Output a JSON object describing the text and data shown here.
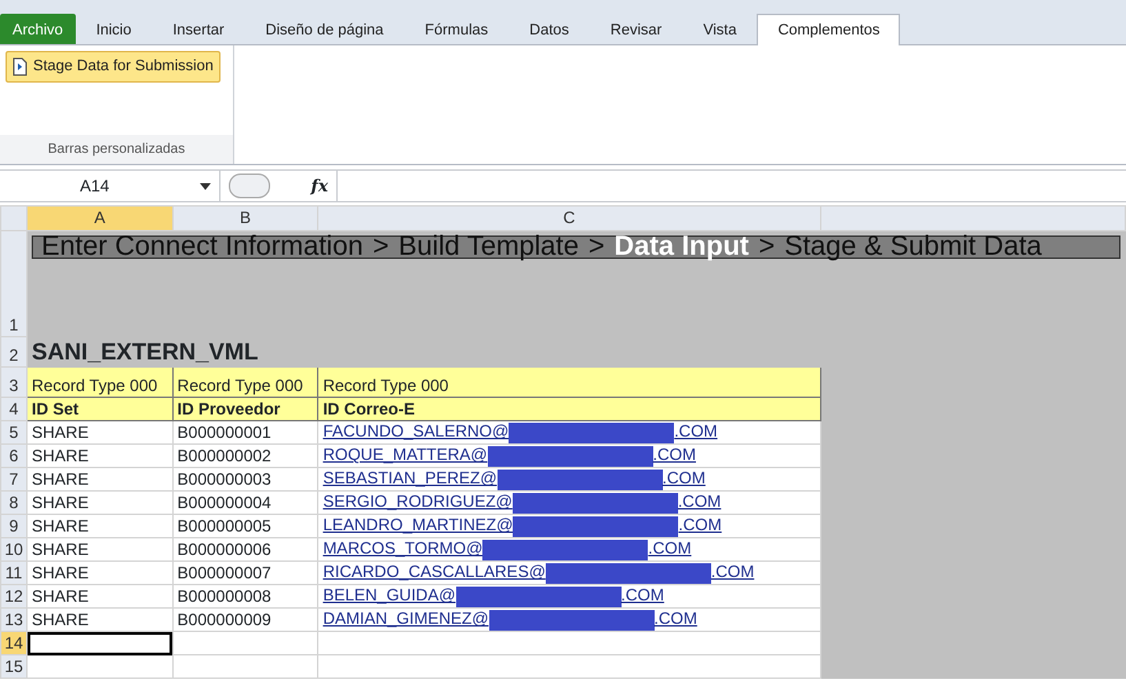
{
  "ribbon_tabs": [
    {
      "label": "Archivo",
      "kind": "file",
      "selected": false
    },
    {
      "label": "Inicio",
      "kind": "tab",
      "selected": false
    },
    {
      "label": "Insertar",
      "kind": "tab",
      "selected": false
    },
    {
      "label": "Diseño de página",
      "kind": "tab",
      "selected": false
    },
    {
      "label": "Fórmulas",
      "kind": "tab",
      "selected": false
    },
    {
      "label": "Datos",
      "kind": "tab",
      "selected": false
    },
    {
      "label": "Revisar",
      "kind": "tab",
      "selected": false
    },
    {
      "label": "Vista",
      "kind": "tab",
      "selected": false
    },
    {
      "label": "Complementos",
      "kind": "tab",
      "selected": true
    }
  ],
  "ribbon": {
    "button": "Stage Data for Submission",
    "group_label": "Barras personalizadas"
  },
  "formula_bar": {
    "name_box": "A14",
    "fx_label": "fx"
  },
  "columns": [
    {
      "label": "A",
      "selected": true
    },
    {
      "label": "B",
      "selected": false
    },
    {
      "label": "C",
      "selected": false
    }
  ],
  "banner": [
    {
      "label": "Enter Connect Information",
      "selected": false
    },
    {
      "label": ">",
      "selected": false
    },
    {
      "label": "Build Template",
      "selected": false
    },
    {
      "label": ">",
      "selected": false
    },
    {
      "label": "Data Input",
      "selected": true
    },
    {
      "label": ">",
      "selected": false
    },
    {
      "label": "Stage & Submit Data",
      "selected": false
    }
  ],
  "sheet_title": "SANI_EXTERN_VML",
  "record_type_row": [
    "Record Type 000",
    "Record Type 000",
    "Record Type 000"
  ],
  "header_row": [
    "ID Set",
    "ID Proveedor",
    "ID Correo-E"
  ],
  "rows": [
    {
      "id_set": "SHARE",
      "id_proveedor": "B000000001",
      "email_user": "FACUNDO_SALERNO@",
      "email_domain": ".COM"
    },
    {
      "id_set": "SHARE",
      "id_proveedor": "B000000002",
      "email_user": "ROQUE_MATTERA@",
      "email_domain": ".COM"
    },
    {
      "id_set": "SHARE",
      "id_proveedor": "B000000003",
      "email_user": "SEBASTIAN_PEREZ@",
      "email_domain": ".COM"
    },
    {
      "id_set": "SHARE",
      "id_proveedor": "B000000004",
      "email_user": "SERGIO_RODRIGUEZ@",
      "email_domain": ".COM"
    },
    {
      "id_set": "SHARE",
      "id_proveedor": "B000000005",
      "email_user": "LEANDRO_MARTINEZ@",
      "email_domain": ".COM"
    },
    {
      "id_set": "SHARE",
      "id_proveedor": "B000000006",
      "email_user": "MARCOS_TORMO@",
      "email_domain": ".COM"
    },
    {
      "id_set": "SHARE",
      "id_proveedor": "B000000007",
      "email_user": "RICARDO_CASCALLARES@",
      "email_domain": ".COM"
    },
    {
      "id_set": "SHARE",
      "id_proveedor": "B000000008",
      "email_user": "BELEN_GUIDA@",
      "email_domain": ".COM"
    },
    {
      "id_set": "SHARE",
      "id_proveedor": "B000000009",
      "email_user": "DAMIAN_GIMENEZ@",
      "email_domain": ".COM"
    }
  ],
  "row_numbers": [
    {
      "label": "1",
      "selected": false
    },
    {
      "label": "2",
      "selected": false
    },
    {
      "label": "3",
      "selected": false
    },
    {
      "label": "4",
      "selected": false
    },
    {
      "label": "5",
      "selected": false
    },
    {
      "label": "6",
      "selected": false
    },
    {
      "label": "7",
      "selected": false
    },
    {
      "label": "8",
      "selected": false
    },
    {
      "label": "9",
      "selected": false
    },
    {
      "label": "10",
      "selected": false
    },
    {
      "label": "11",
      "selected": false
    },
    {
      "label": "12",
      "selected": false
    },
    {
      "label": "13",
      "selected": false
    },
    {
      "label": "14",
      "selected": true
    },
    {
      "label": "15",
      "selected": false
    }
  ]
}
